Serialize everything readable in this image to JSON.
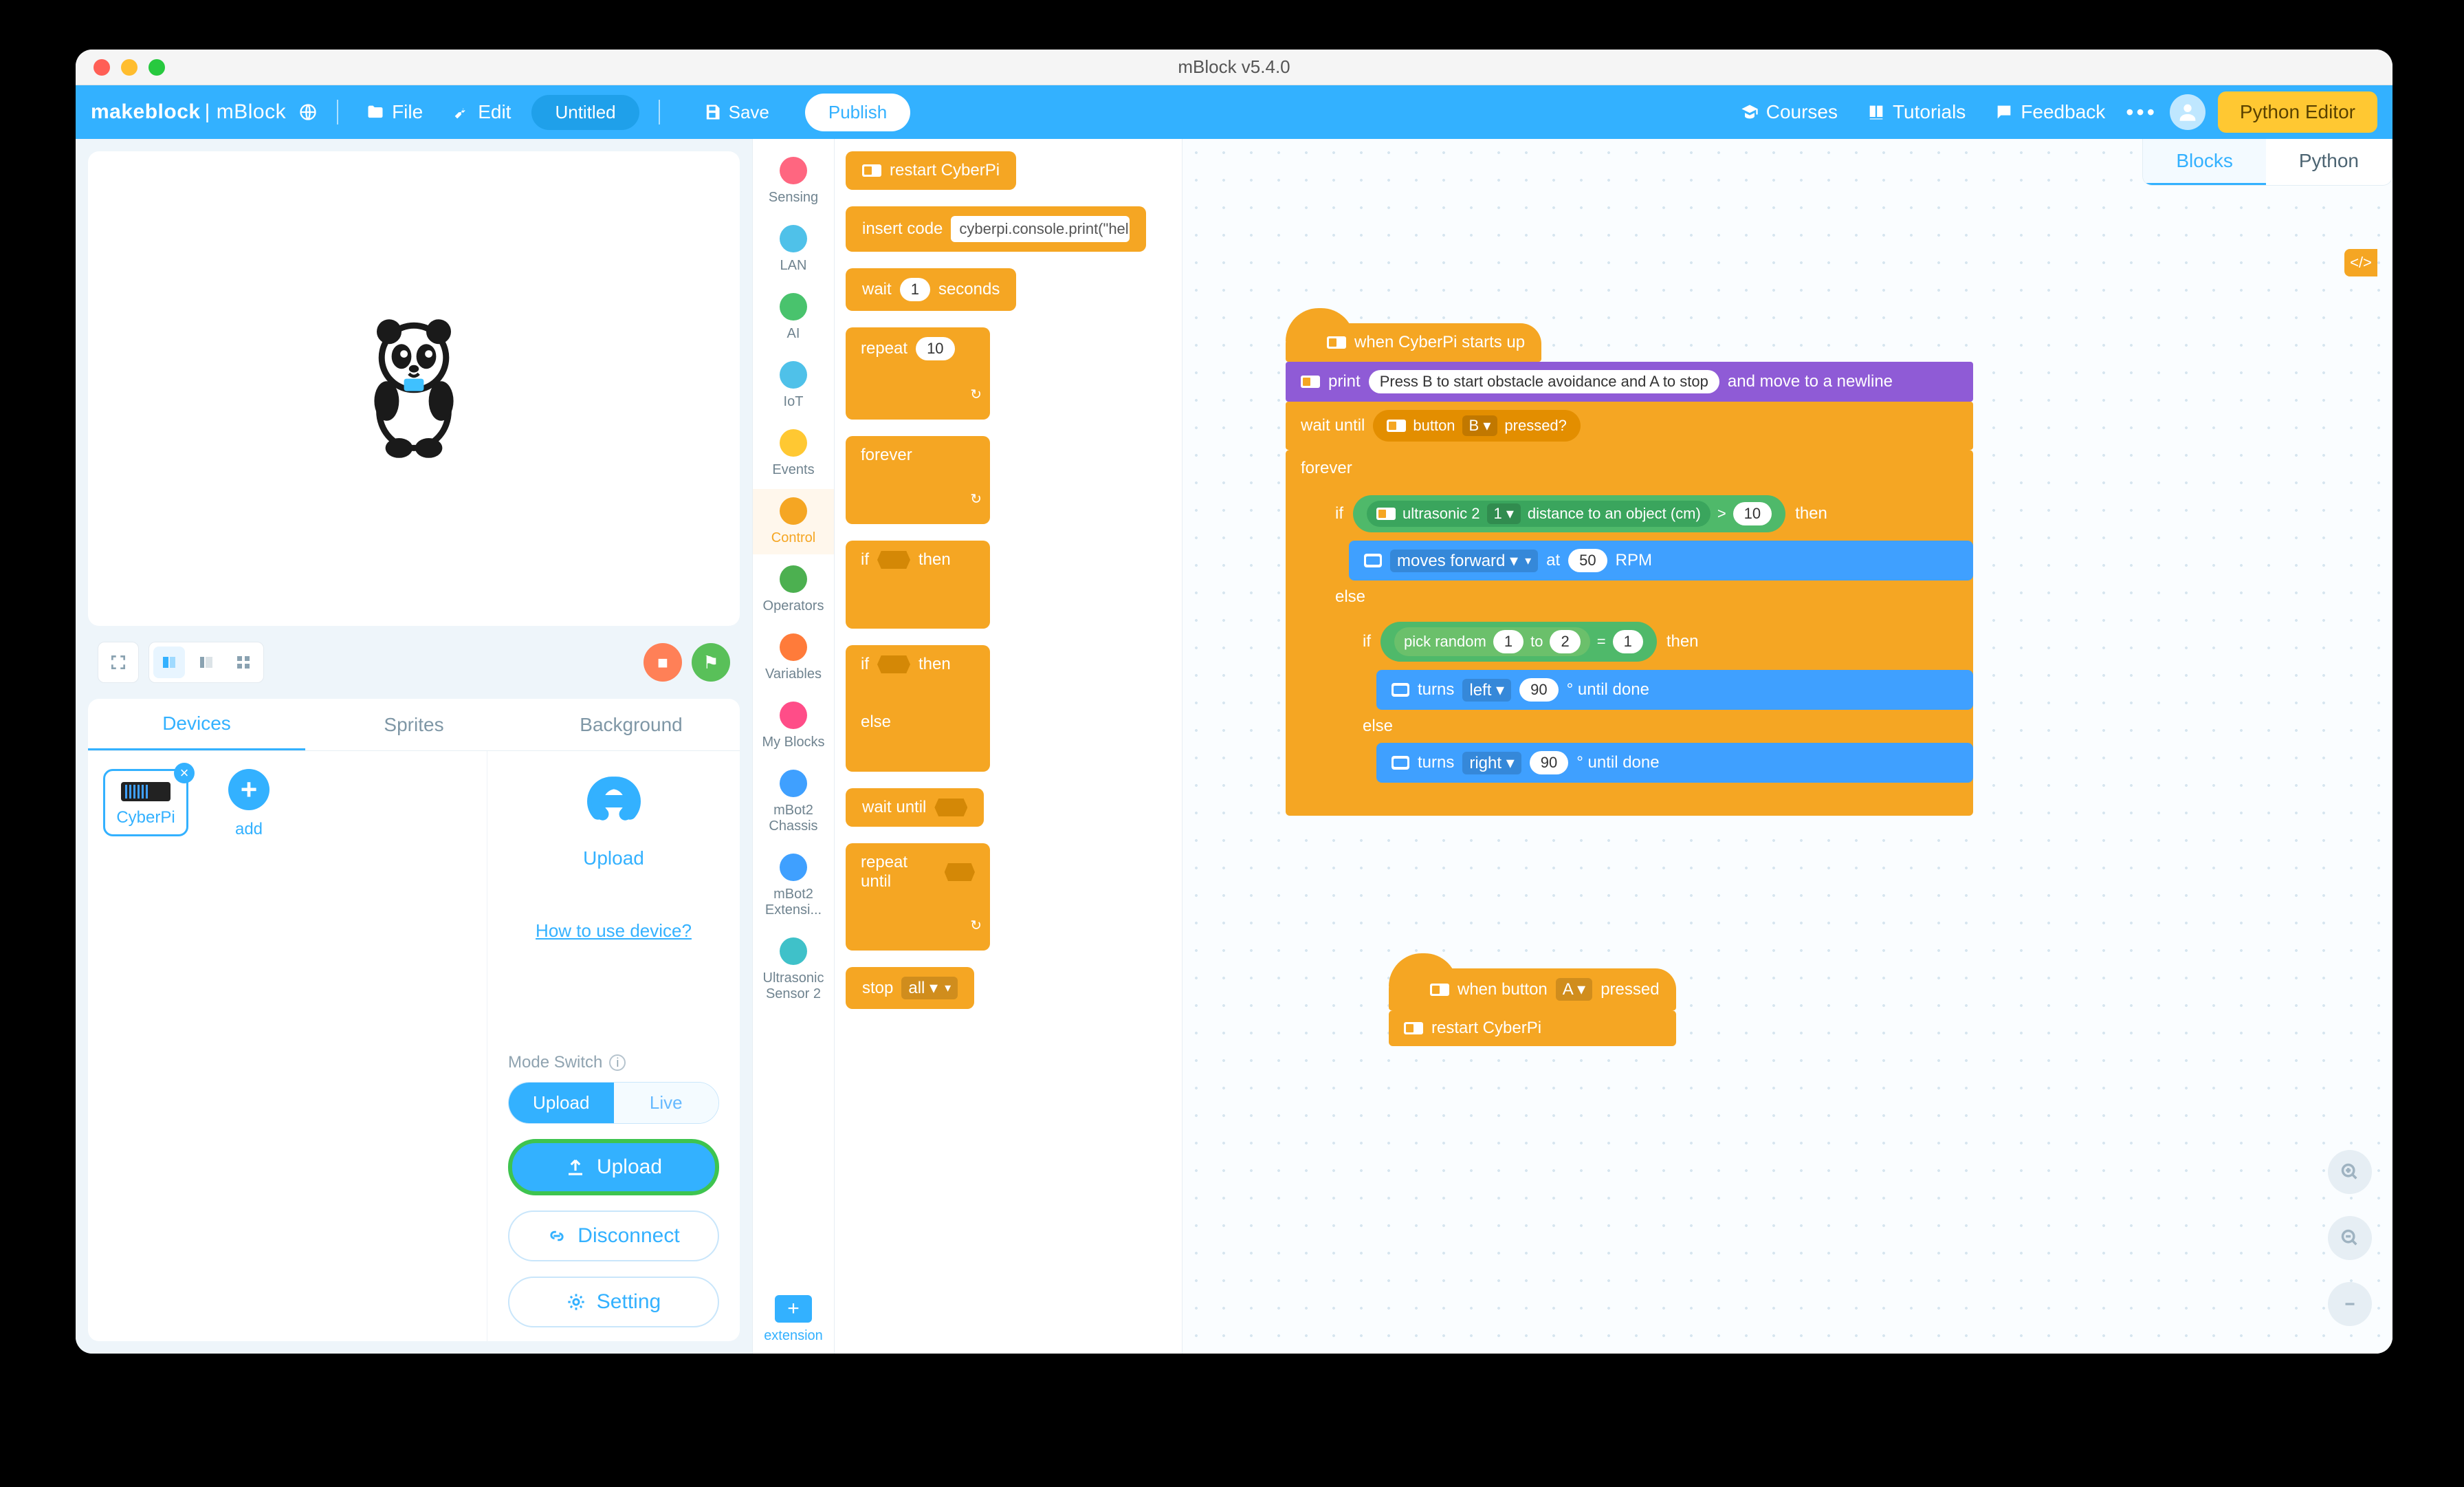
{
  "window": {
    "title": "mBlock v5.4.0"
  },
  "topbar": {
    "brand_a": "makeblock",
    "brand_b": "| mBlock",
    "file": "File",
    "edit": "Edit",
    "project_title": "Untitled",
    "save": "Save",
    "publish": "Publish",
    "courses": "Courses",
    "tutorials": "Tutorials",
    "feedback": "Feedback",
    "python_editor": "Python Editor"
  },
  "stage": {
    "stop": "■",
    "flag": "⚑"
  },
  "left_tabs": {
    "devices": "Devices",
    "sprites": "Sprites",
    "background": "Background"
  },
  "devices": {
    "selected": "CyberPi",
    "add": "add",
    "upload_title": "Upload",
    "howto": "How to use device?",
    "mode_label": "Mode Switch",
    "seg_upload": "Upload",
    "seg_live": "Live",
    "btn_upload": "Upload",
    "btn_disconnect": "Disconnect",
    "btn_setting": "Setting"
  },
  "categories": [
    {
      "id": "sensing",
      "label": "Sensing",
      "color": "c-sensing"
    },
    {
      "id": "lan",
      "label": "LAN",
      "color": "c-lan"
    },
    {
      "id": "ai",
      "label": "AI",
      "color": "c-ai"
    },
    {
      "id": "iot",
      "label": "IoT",
      "color": "c-iot"
    },
    {
      "id": "events",
      "label": "Events",
      "color": "c-events"
    },
    {
      "id": "control",
      "label": "Control",
      "color": "c-control",
      "active": true
    },
    {
      "id": "operators",
      "label": "Operators",
      "color": "c-ops"
    },
    {
      "id": "variables",
      "label": "Variables",
      "color": "c-vars"
    },
    {
      "id": "myblocks",
      "label": "My Blocks",
      "color": "c-myblk"
    },
    {
      "id": "mbot2c",
      "label": "mBot2 Chassis",
      "color": "c-mbot"
    },
    {
      "id": "mbot2e",
      "label": "mBot2 Extensi...",
      "color": "c-mbote"
    },
    {
      "id": "ultra",
      "label": "Ultrasonic Sensor 2",
      "color": "c-us"
    }
  ],
  "extension": "extension",
  "palette": {
    "restart": "restart CyberPi",
    "insert_code": "insert code",
    "code_sample": "cyberpi.console.print(\"hello",
    "wait": "wait",
    "wait_n": "1",
    "wait_unit": "seconds",
    "repeat": "repeat",
    "repeat_n": "10",
    "forever": "forever",
    "if": "if",
    "then": "then",
    "else": "else",
    "wait_until": "wait until",
    "repeat_until": "repeat until",
    "stop": "stop",
    "stop_opt": "all ▾"
  },
  "code_tabs": {
    "blocks": "Blocks",
    "python": "Python"
  },
  "script1": {
    "hat": "when CyberPi starts up",
    "print": "print",
    "print_text": "Press B to start obstacle avoidance and A to stop",
    "print_tail": "and move to a newline",
    "wait_until": "wait until",
    "btn": "button",
    "btn_b": "B ▾",
    "pressed": "pressed?",
    "forever": "forever",
    "if": "if",
    "ultra": "ultrasonic 2",
    "ultra_port": "1 ▾",
    "ultra_meas": "distance to an object (cm)",
    "gt": ">",
    "ten": "10",
    "then": "then",
    "moves": "moves forward ▾",
    "at": "at",
    "fifty": "50",
    "rpm": "RPM",
    "else": "else",
    "if2": "if",
    "pick": "pick random",
    "p1": "1",
    "p_to": "to",
    "p2": "2",
    "eq": "=",
    "p1b": "1",
    "then2": "then",
    "turns": "turns",
    "left": "left ▾",
    "right": "right ▾",
    "ninety": "90",
    "until_done": "° until done",
    "else2": "else"
  },
  "script2": {
    "hat": "when button",
    "btn_a": "A ▾",
    "pressed": "pressed",
    "restart": "restart CyberPi"
  }
}
